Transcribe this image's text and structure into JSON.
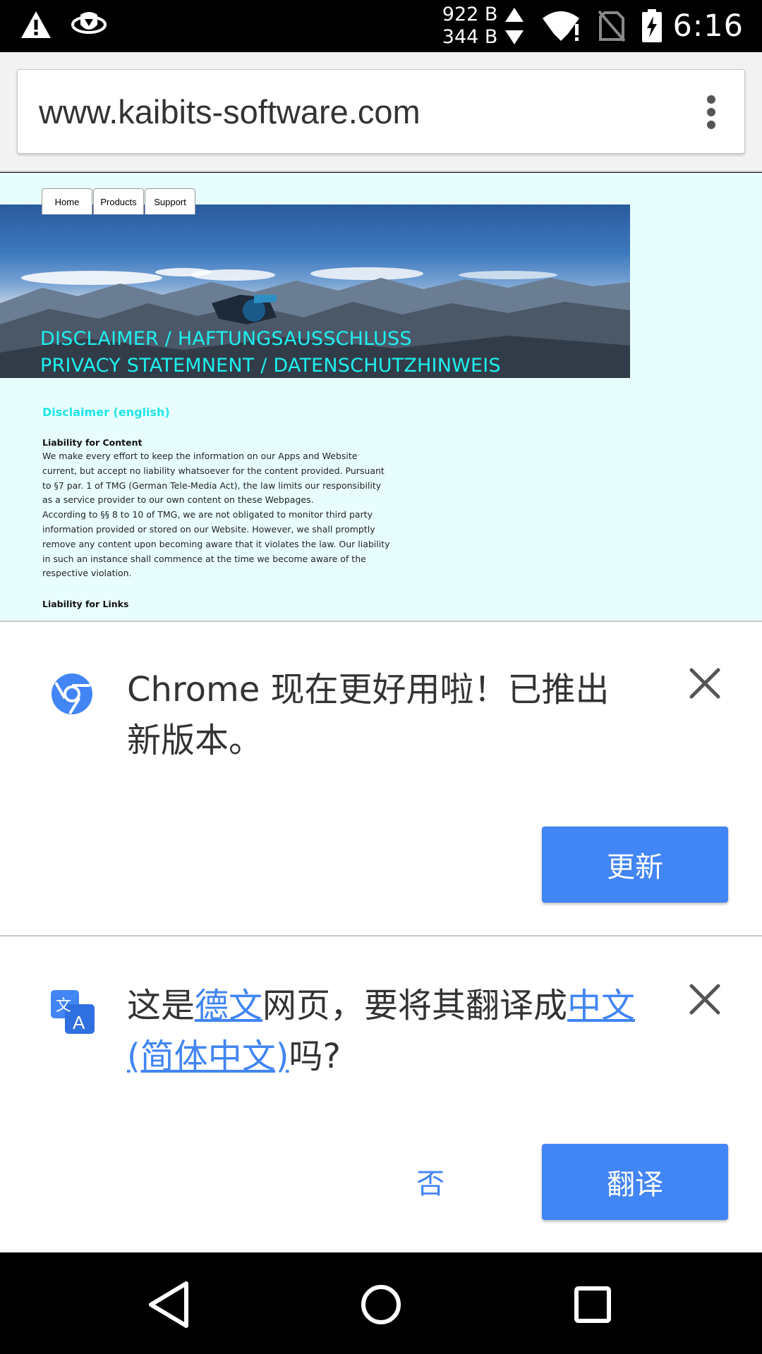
{
  "status_bar": {
    "net_down": "922 B",
    "net_up": "344 B",
    "time": "6:16",
    "icons": [
      "warning-icon",
      "vpn-icon",
      "wifi-icon",
      "no-sim-icon",
      "battery-charging-icon"
    ]
  },
  "browser": {
    "url": "www.kaibits-software.com",
    "menu_icon": "more-vert-icon"
  },
  "page": {
    "nav": [
      "Home",
      "Products",
      "Support"
    ],
    "hero_title_1": "DISCLAIMER / HAFTUNGSAUSSCHLUSS",
    "hero_title_2": "PRIVACY STATEMNENT / DATENSCHUTZHINWEIS",
    "heading": "Disclaimer (english)",
    "section_1_title": "Liability for Content",
    "section_1_lines": [
      "We make every effort to keep the information on our Apps and Website",
      "current, but accept no liability whatsoever for the content provided. Pursuant",
      "to §7 par. 1 of TMG (German Tele-Media Act), the law limits our responsibility",
      "as a service provider to our own content on these Webpages.",
      "According to §§ 8 to 10 of TMG, we are not obligated to monitor third party",
      "information provided or stored on our Website. However, we shall promptly",
      "remove any content upon becoming aware that it violates the law. Our liability",
      "in such an instance shall commence at the time we become aware of the",
      "respective violation."
    ],
    "section_2_title": "Liability for Links"
  },
  "update_infobar": {
    "message": "Chrome 现在更好用啦！已推出新版本。",
    "button": "更新"
  },
  "translate_infobar": {
    "text_before": "这是",
    "source_language": "德文",
    "text_middle": "网页，要将其翻译成",
    "target_language": "中文(简体中文)",
    "text_after": "吗?",
    "decline_button": "否",
    "translate_button": "翻译"
  },
  "colors": {
    "accent": "#4285f4",
    "page_bg": "#e8fefe",
    "hero_text": "#1ef0f0"
  }
}
